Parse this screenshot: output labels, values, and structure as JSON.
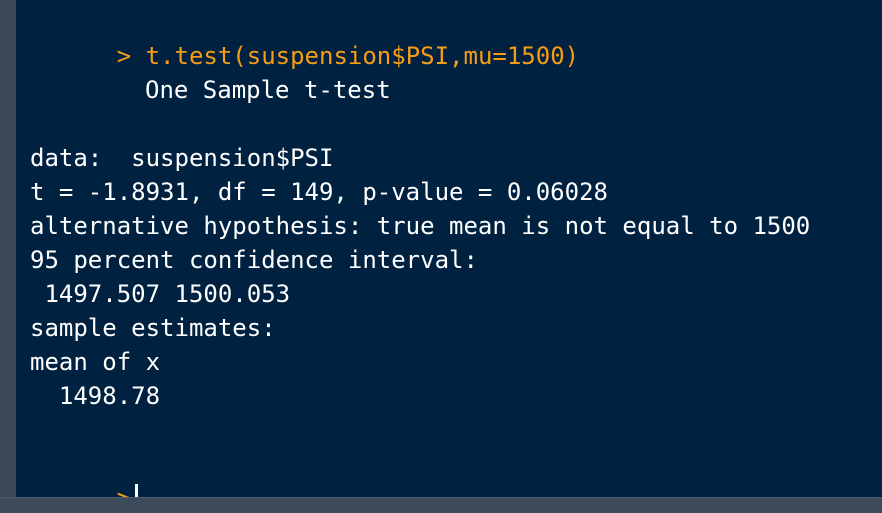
{
  "console": {
    "previous_output_fragment": "---   ----  -----   -----  ---  ----  ----",
    "prompt_symbol": ">",
    "command": "t.test(suspension$PSI,mu=1500)",
    "output": {
      "heading": "One Sample t-test",
      "data_line": "data:  suspension$PSI",
      "stats_line": "t = -1.8931, df = 149, p-value = 0.06028",
      "alternative_line": "alternative hypothesis: true mean is not equal to 1500",
      "ci_label": "95 percent confidence interval:",
      "ci_values": " 1497.507 1500.053",
      "estimates_label": "sample estimates:",
      "estimates_header": "mean of x",
      "estimates_value": "  1498.78"
    },
    "next_prompt_symbol": ">"
  },
  "colors": {
    "console_background": "#002240",
    "prompt_command": "#f59d16",
    "output_text": "#ffffff"
  }
}
